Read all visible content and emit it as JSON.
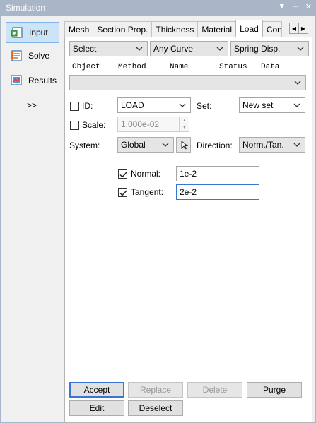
{
  "window": {
    "title": "Simulation",
    "ctrl_dropdown": "▼",
    "ctrl_pin": "⊣",
    "ctrl_close": "✕"
  },
  "sidebar": {
    "items": [
      {
        "label": "Input",
        "icon": "input-icon",
        "active": true
      },
      {
        "label": "Solve",
        "icon": "solve-icon",
        "active": false
      },
      {
        "label": "Results",
        "icon": "results-icon",
        "active": false
      }
    ],
    "expand": ">>"
  },
  "tabs": [
    {
      "label": "Mesh"
    },
    {
      "label": "Section Prop."
    },
    {
      "label": "Thickness"
    },
    {
      "label": "Material"
    },
    {
      "label": "Load",
      "active": true
    },
    {
      "label": "Con"
    }
  ],
  "filters": {
    "select": "Select",
    "curve": "Any Curve",
    "type": "Spring Disp."
  },
  "columns": [
    "Object",
    "Method",
    "Name",
    "Status",
    "Data"
  ],
  "form": {
    "id_label": "ID:",
    "id_value": "LOAD",
    "set_label": "Set:",
    "set_value": "New set",
    "scale_label": "Scale:",
    "scale_value": "1.000e-02",
    "system_label": "System:",
    "system_value": "Global",
    "direction_label": "Direction:",
    "direction_value": "Norm./Tan.",
    "normal_label": "Normal:",
    "normal_value": "1e-2",
    "tangent_label": "Tangent:",
    "tangent_value": "2e-2"
  },
  "buttons": {
    "accept": "Accept",
    "replace": "Replace",
    "delete": "Delete",
    "purge": "Purge",
    "edit": "Edit",
    "deselect": "Deselect"
  },
  "colors": {
    "titlebar": "#a8b6c8",
    "active_side": "#cde4f7",
    "focus": "#3875d7"
  }
}
